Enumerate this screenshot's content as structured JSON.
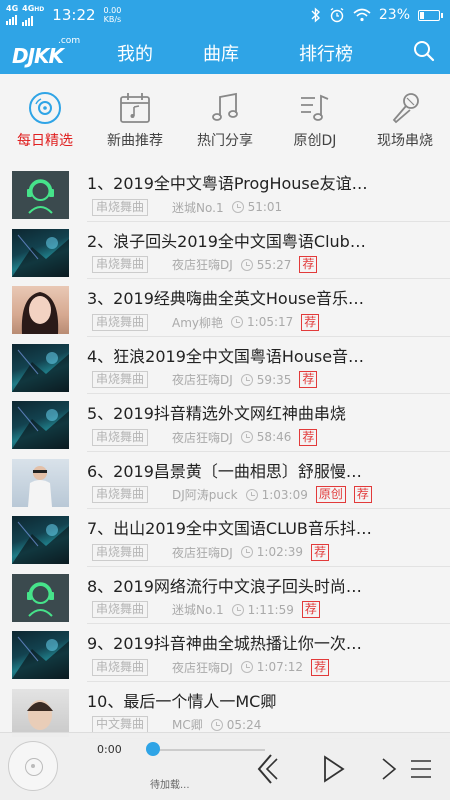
{
  "statusbar": {
    "sim1": "4G",
    "sim2": "4G",
    "sim2_sub": "HD",
    "time": "13:22",
    "speed_value": "0.00",
    "speed_unit": "KB/s",
    "battery": "23%"
  },
  "nav": {
    "logo_text": "DJKK",
    "logo_com": ".com",
    "tabs": [
      "我的",
      "曲库",
      "排行榜"
    ]
  },
  "categories": [
    {
      "label": "每日精选",
      "icon": "disc-icon",
      "active": true
    },
    {
      "label": "新曲推荐",
      "icon": "calendar-music-icon",
      "active": false
    },
    {
      "label": "热门分享",
      "icon": "music-note-icon",
      "active": false
    },
    {
      "label": "原创DJ",
      "icon": "note-list-icon",
      "active": false
    },
    {
      "label": "现场串烧",
      "icon": "microphone-icon",
      "active": false
    }
  ],
  "tracks": [
    {
      "title": "1、2019全中文粤语ProgHouse友谊…",
      "genre": "串烧舞曲",
      "artist": "迷城No.1",
      "duration": "51:01",
      "badges": [],
      "thumb": "dj-avatar-icon"
    },
    {
      "title": "2、浪子回头2019全中文国粤语Club…",
      "genre": "串烧舞曲",
      "artist": "夜店狂嗨DJ",
      "duration": "55:27",
      "badges": [
        "荐"
      ],
      "thumb": "club-photo"
    },
    {
      "title": "3、2019经典嗨曲全英文House音乐…",
      "genre": "串烧舞曲",
      "artist": "Amy柳艳",
      "duration": "1:05:17",
      "badges": [
        "荐"
      ],
      "thumb": "girl-photo"
    },
    {
      "title": "4、狂浪2019全中文国粤语House音…",
      "genre": "串烧舞曲",
      "artist": "夜店狂嗨DJ",
      "duration": "59:35",
      "badges": [
        "荐"
      ],
      "thumb": "club-photo"
    },
    {
      "title": "5、2019抖音精选外文网红神曲串烧",
      "genre": "串烧舞曲",
      "artist": "夜店狂嗨DJ",
      "duration": "58:46",
      "badges": [
        "荐"
      ],
      "thumb": "club-photo"
    },
    {
      "title": "6、2019昌景黄〔一曲相思〕舒服慢…",
      "genre": "串烧舞曲",
      "artist": "DJ阿涛puck",
      "duration": "1:03:09",
      "badges": [
        "原创",
        "荐"
      ],
      "thumb": "man-photo"
    },
    {
      "title": "7、出山2019全中文国语CLUB音乐抖…",
      "genre": "串烧舞曲",
      "artist": "夜店狂嗨DJ",
      "duration": "1:02:39",
      "badges": [
        "荐"
      ],
      "thumb": "club-photo"
    },
    {
      "title": "8、2019网络流行中文浪子回头时尚…",
      "genre": "串烧舞曲",
      "artist": "迷城No.1",
      "duration": "1:11:59",
      "badges": [
        "荐"
      ],
      "thumb": "dj-avatar-icon"
    },
    {
      "title": "9、2019抖音神曲全城热播让你一次…",
      "genre": "串烧舞曲",
      "artist": "夜店狂嗨DJ",
      "duration": "1:07:12",
      "badges": [
        "荐"
      ],
      "thumb": "club-photo"
    },
    {
      "title": "10、最后一个情人一MC卿",
      "genre": "中文舞曲",
      "artist": "MC卿",
      "duration": "05:24",
      "badges": [],
      "thumb": "boy-photo"
    }
  ],
  "player": {
    "time": "0:00",
    "status": "待加载..."
  },
  "colors": {
    "brand_blue": "#2fa4e6",
    "active_red": "#e02020",
    "badge_red": "#e23a3a"
  }
}
